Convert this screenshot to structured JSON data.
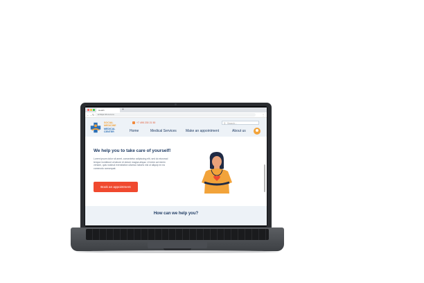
{
  "browser": {
    "tab_title": "Health",
    "new_tab": "+",
    "url": "● https://cl.com.ru",
    "back": "←",
    "forward": "→",
    "reload": "↻",
    "menu": "⋮"
  },
  "site": {
    "logo_lines": [
      "SOCIAL",
      "MEDICINE",
      "MEDICAL",
      "CENTER"
    ],
    "phone": "+7 495 230 21 50",
    "search_placeholder": "Search...",
    "search_icon": "search-icon",
    "nav": [
      "Home",
      "Medical Services",
      "Make an appointment",
      "About us"
    ],
    "avatar_icon": "user-icon"
  },
  "hero": {
    "title": "We help you to take care of yourself!",
    "text": "Lorem ipsum dolor sit amet, consectetur adipiscing elit, sed do eiusmod tempor incididunt ut labore et dolore magna aliqua. Ut enim ad minim veniam, quis nostrud exercitation ullamco laboris nisi ut aliquip ex ea commodo consequat.",
    "cta": "Book an appointment",
    "illustration": "doctor-illustration"
  },
  "help": {
    "title": "How can we help you?"
  },
  "colors": {
    "accent": "#f0492f",
    "navy": "#1f3b63",
    "header_bg": "#edf2f7",
    "logo_orange": "#f2a33a",
    "logo_blue": "#2c6fb5"
  }
}
